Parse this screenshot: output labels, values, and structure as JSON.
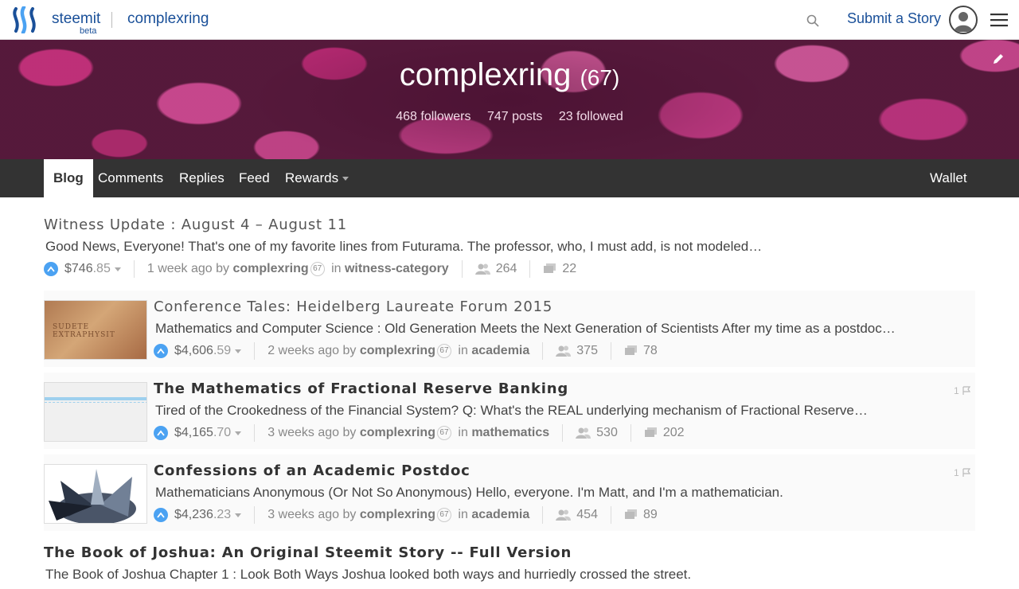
{
  "header": {
    "brand": "steemit",
    "beta": "beta",
    "breadcrumb": "complexring",
    "submit_label": "Submit a Story"
  },
  "profile": {
    "name": "complexring",
    "reputation": "(67)",
    "followers": "468 followers",
    "posts": "747 posts",
    "followed": "23 followed"
  },
  "tabs": {
    "blog": "Blog",
    "comments": "Comments",
    "replies": "Replies",
    "feed": "Feed",
    "rewards": "Rewards",
    "wallet": "Wallet"
  },
  "posts": [
    {
      "title": "Witness Update : August 4 – August 11",
      "body": "Good News, Everyone! That's one of my favorite lines from Futurama. The professor, who, I must add, is not modeled…",
      "payout_main": "$746",
      "payout_cents": ".85",
      "time": "1 week ago by",
      "author": "complexring",
      "rep": "67",
      "in": "in",
      "category": "witness-category",
      "votes": "264",
      "comments": "22"
    },
    {
      "title": "Conference Tales: Heidelberg Laureate Forum 2015",
      "body": "Mathematics and Computer Science : Old Generation Meets the Next Generation of Scientists After my time as a postdoc…",
      "payout_main": "$4,606",
      "payout_cents": ".59",
      "time": "2 weeks ago by",
      "author": "complexring",
      "rep": "67",
      "in": "in",
      "category": "academia",
      "votes": "375",
      "comments": "78",
      "thumb_text": "SUDETE EXTRAPHYSIT"
    },
    {
      "title": "The Mathematics of Fractional Reserve Banking",
      "body": "Tired of the Crookedness of the Financial System? Q: What's the REAL underlying mechanism of Fractional Reserve…",
      "payout_main": "$4,165",
      "payout_cents": ".70",
      "time": "3 weeks ago by",
      "author": "complexring",
      "rep": "67",
      "in": "in",
      "category": "mathematics",
      "votes": "530",
      "comments": "202",
      "flag_count": "1"
    },
    {
      "title": "Confessions of an Academic Postdoc",
      "body": "Mathematicians Anonymous (Or Not So Anonymous) Hello, everyone. I'm Matt, and I'm a mathematician.",
      "payout_main": "$4,236",
      "payout_cents": ".23",
      "time": "3 weeks ago by",
      "author": "complexring",
      "rep": "67",
      "in": "in",
      "category": "academia",
      "votes": "454",
      "comments": "89",
      "flag_count": "1"
    },
    {
      "title": "The Book of Joshua: An Original Steemit Story -- Full Version",
      "body": "The Book of Joshua Chapter 1 : Look Both Ways Joshua looked both ways and hurriedly crossed the street."
    }
  ],
  "colors": {
    "brand": "#1a5099",
    "tabbar": "#333333",
    "vote": "#4ba2f2",
    "banner": "#c8327e"
  }
}
